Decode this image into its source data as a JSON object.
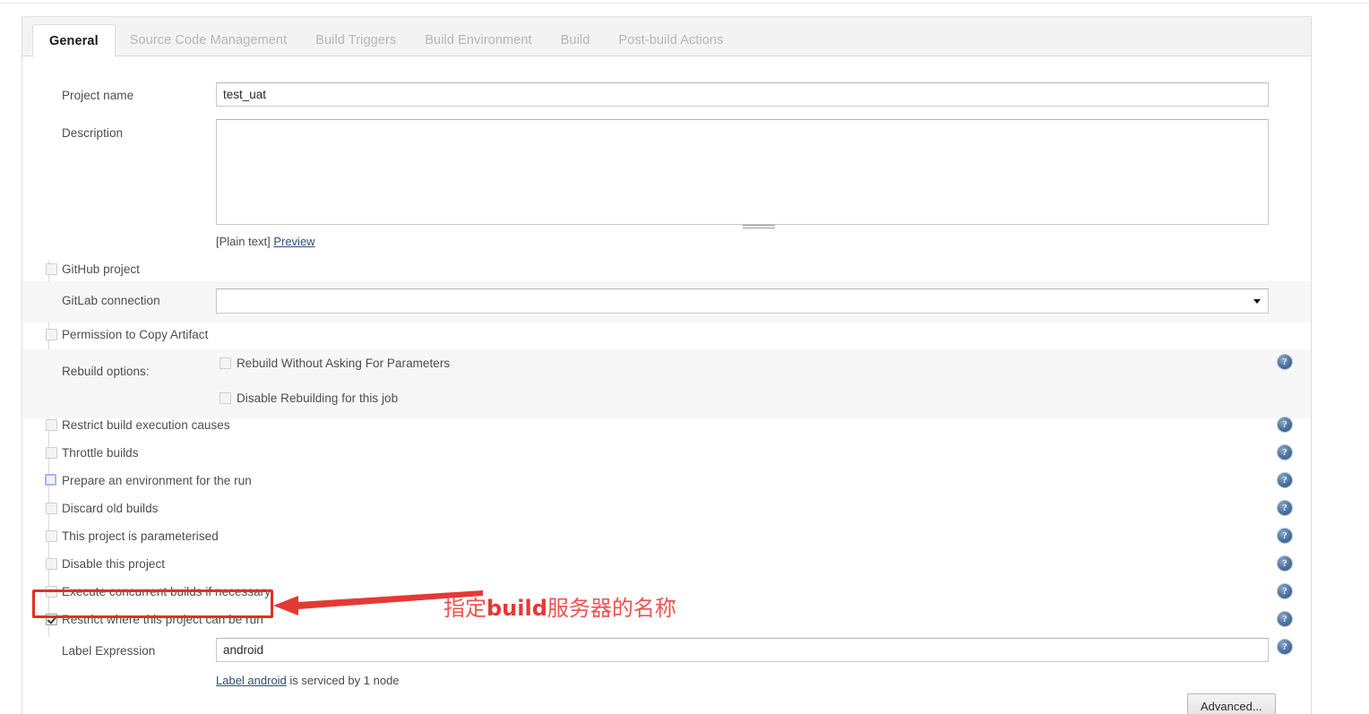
{
  "tabs": [
    {
      "label": "General",
      "active": true
    },
    {
      "label": "Source Code Management",
      "active": false
    },
    {
      "label": "Build Triggers",
      "active": false
    },
    {
      "label": "Build Environment",
      "active": false
    },
    {
      "label": "Build",
      "active": false
    },
    {
      "label": "Post-build Actions",
      "active": false
    }
  ],
  "form": {
    "project_name": {
      "label": "Project name",
      "value": "test_uat",
      "placeholder": ""
    },
    "description": {
      "label": "Description",
      "value": "",
      "placeholder": "",
      "plain_text": "[Plain text]",
      "preview_link": "Preview"
    },
    "github_project": {
      "label": "GitHub project",
      "checked": false
    },
    "gitlab_connection": {
      "label": "GitLab connection",
      "value": "",
      "arrow": "chevron-down-icon"
    },
    "permission_copy_artifact": {
      "label": "Permission to Copy Artifact",
      "checked": false
    },
    "rebuild_options": {
      "label": "Rebuild options:",
      "items": [
        {
          "label": "Rebuild Without Asking For Parameters",
          "checked": false
        },
        {
          "label": "Disable Rebuilding for this job",
          "checked": false
        }
      ]
    },
    "options": [
      {
        "label": "Restrict build execution causes",
        "checked": false,
        "state": "pale"
      },
      {
        "label": "Throttle builds",
        "checked": false,
        "state": "pale"
      },
      {
        "label": "Prepare an environment for the run",
        "checked": false,
        "state": "focus"
      },
      {
        "label": "Discard old builds",
        "checked": false,
        "state": "pale"
      },
      {
        "label": "This project is parameterised",
        "checked": false,
        "state": "pale"
      },
      {
        "label": "Disable this project",
        "checked": false,
        "state": "pale"
      },
      {
        "label": "Execute concurrent builds if necessary",
        "checked": false,
        "state": "pale"
      },
      {
        "label": "Restrict where this project can be run",
        "checked": true,
        "state": "checked"
      }
    ],
    "label_expression": {
      "label": "Label Expression",
      "value": "android",
      "note_link": "Label android",
      "note_rest": " is serviced by 1 node"
    },
    "advanced_button": "Advanced..."
  },
  "annotation": {
    "text_prefix": "指定",
    "text_bold": "build",
    "text_suffix": "服务器的名称",
    "box_color": "#e03124",
    "arrow_color": "#e53935",
    "text_color": "#ef5350"
  },
  "icons": {
    "help": "help-icon"
  }
}
